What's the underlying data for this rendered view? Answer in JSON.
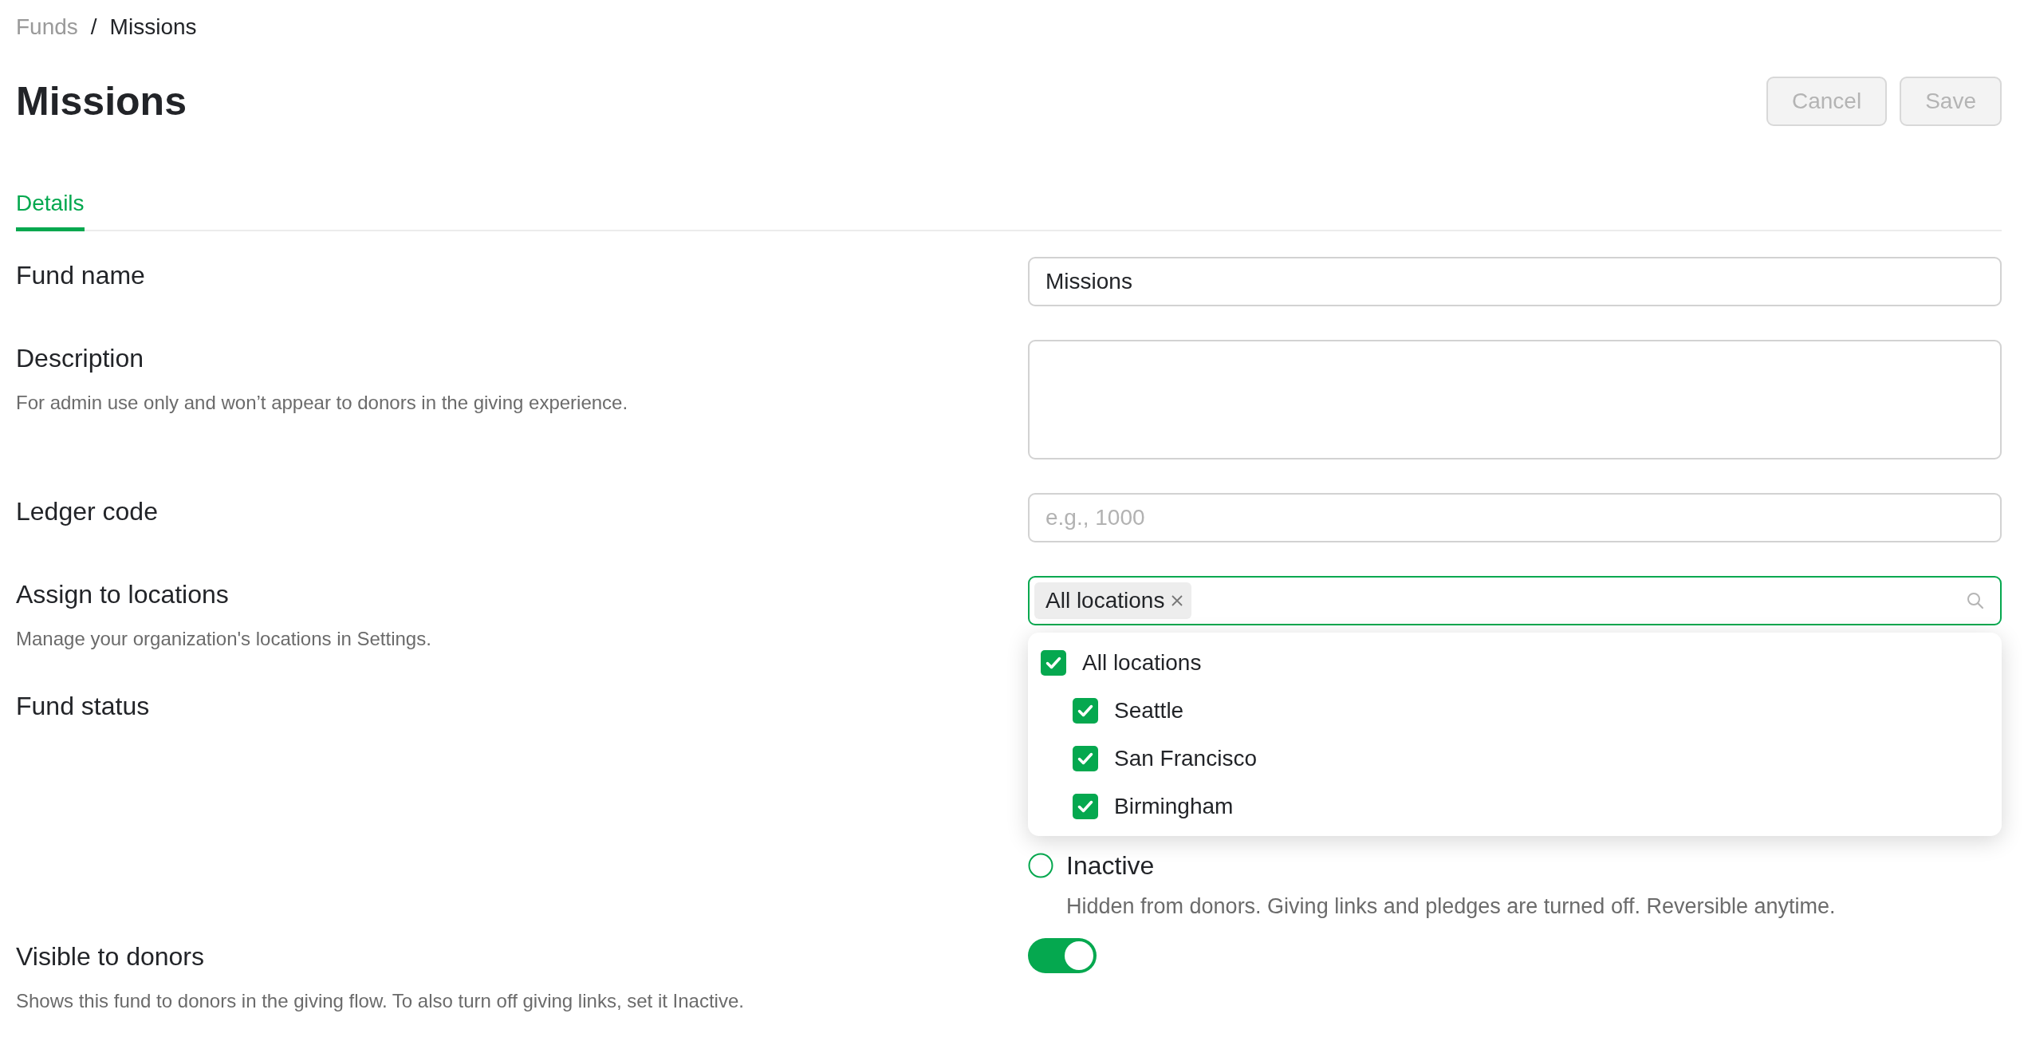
{
  "breadcrumb": {
    "separator": "/",
    "items": [
      {
        "label": "Funds",
        "current": false
      },
      {
        "label": "Missions",
        "current": true
      }
    ]
  },
  "title": "Missions",
  "actions": [
    {
      "label": "Cancel",
      "disabled": true
    },
    {
      "label": "Save",
      "disabled": true
    }
  ],
  "tabs": [
    {
      "label": "Details",
      "selected": true
    }
  ],
  "fields": [
    {
      "kind": "text",
      "label": "Fund name",
      "value": "Missions"
    },
    {
      "kind": "textarea",
      "label": "Description",
      "help": "For admin use only and won’t appear to donors in the giving experience."
    },
    {
      "kind": "text",
      "label": "Ledger code",
      "placeholder": "e.g., 1000"
    },
    {
      "kind": "locations",
      "label": "Assign to locations",
      "help": "Manage your organization's locations in Settings.",
      "tags": [
        {
          "label": "All locations"
        }
      ],
      "dropdown": {
        "expanded": true,
        "options": [
          {
            "label": "All locations",
            "checked": true,
            "children": [
              {
                "label": "Seattle",
                "checked": true
              },
              {
                "label": "San Francisco",
                "checked": true
              },
              {
                "label": "Birmingham",
                "checked": true
              }
            ]
          }
        ]
      }
    },
    {
      "kind": "radio",
      "label": "Fund status",
      "options": [
        {
          "label": "Inactive",
          "selected": false,
          "description": "Hidden from donors. Giving links and pledges are turned off. Reversible anytime."
        }
      ]
    },
    {
      "kind": "toggle",
      "label": "Visible to donors",
      "help": "Shows this fund to donors in the giving flow. To also turn off giving links, set it Inactive.",
      "on": true
    }
  ]
}
